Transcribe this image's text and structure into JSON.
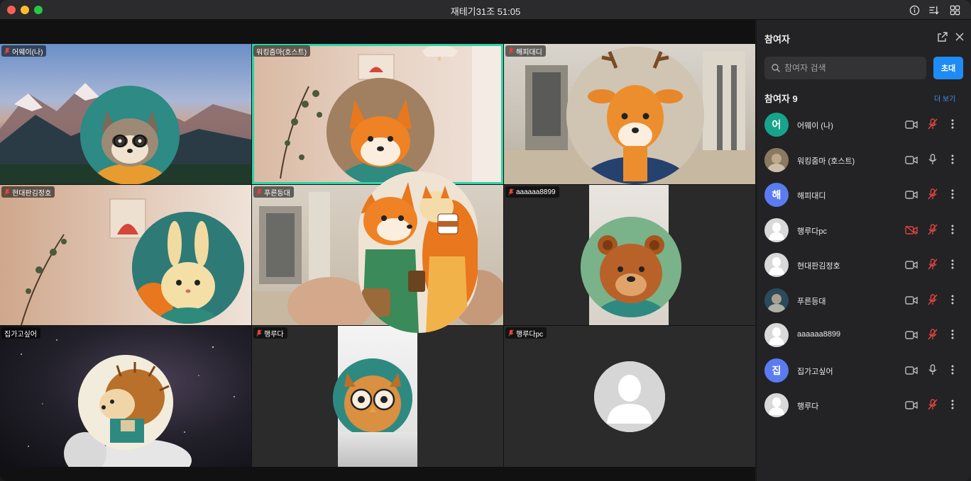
{
  "window": {
    "title": "재테기31조 51:05"
  },
  "tiles": [
    {
      "name": "어웨이(나)",
      "muted": true,
      "bg": "mountain",
      "avatar": "raccoon"
    },
    {
      "name": "워킹줌마(호스트)",
      "muted": false,
      "bg": "cafe",
      "avatar": "fox",
      "host": true
    },
    {
      "name": "해피대디",
      "muted": true,
      "bg": "lobby",
      "avatar": "deer"
    },
    {
      "name": "현대판김정호",
      "muted": true,
      "bg": "cafe",
      "avatar": "rabbit"
    },
    {
      "name": "푸른등대",
      "muted": true,
      "bg": "lobby",
      "avatar": "fox-squirrel"
    },
    {
      "name": "aaaaaa8899",
      "muted": true,
      "bg": "room",
      "avatar": "bear"
    },
    {
      "name": "집가고싶어",
      "muted": false,
      "bg": "space",
      "avatar": "hedgehog"
    },
    {
      "name": "행루다",
      "muted": true,
      "bg": "dark",
      "avatar": "owl"
    },
    {
      "name": "행루다pc",
      "muted": true,
      "bg": "dark",
      "avatar": "default"
    }
  ],
  "panel": {
    "title": "참여자",
    "search_placeholder": "참여자 검색",
    "invite_label": "초대",
    "count_label": "참여자 9",
    "more_label": "더 보기",
    "participants": [
      {
        "name": "어웨이  (나)",
        "avatar_type": "initial",
        "initial": "어",
        "color": "#16a58a",
        "cam": "on",
        "mic": "off-red"
      },
      {
        "name": "워킹줌마  (호스트)",
        "avatar_type": "photo",
        "initial": "",
        "color": "#8a7a62",
        "cam": "on",
        "mic": "on"
      },
      {
        "name": "해피대디",
        "avatar_type": "initial",
        "initial": "해",
        "color": "#5a7cf0",
        "cam": "on",
        "mic": "off-red"
      },
      {
        "name": "행루다pc",
        "avatar_type": "default",
        "initial": "",
        "color": "#d9d9d9",
        "cam": "off-red",
        "mic": "off-red"
      },
      {
        "name": "현대판김정호",
        "avatar_type": "default",
        "initial": "",
        "color": "#d9d9d9",
        "cam": "on",
        "mic": "off-red"
      },
      {
        "name": "푸른등대",
        "avatar_type": "photo",
        "initial": "",
        "color": "#2b4a5a",
        "cam": "on",
        "mic": "off-red"
      },
      {
        "name": "aaaaaa8899",
        "avatar_type": "default",
        "initial": "",
        "color": "#d9d9d9",
        "cam": "on",
        "mic": "off-red"
      },
      {
        "name": "집가고싶어",
        "avatar_type": "initial",
        "initial": "집",
        "color": "#5a7cf0",
        "cam": "on",
        "mic": "on"
      },
      {
        "name": "행루다",
        "avatar_type": "default",
        "initial": "",
        "color": "#d9d9d9",
        "cam": "on",
        "mic": "off-red"
      }
    ]
  },
  "colors": {
    "accent": "#1f8cf5",
    "host_border": "#2fd3a6",
    "muted_red": "#e0443e"
  }
}
